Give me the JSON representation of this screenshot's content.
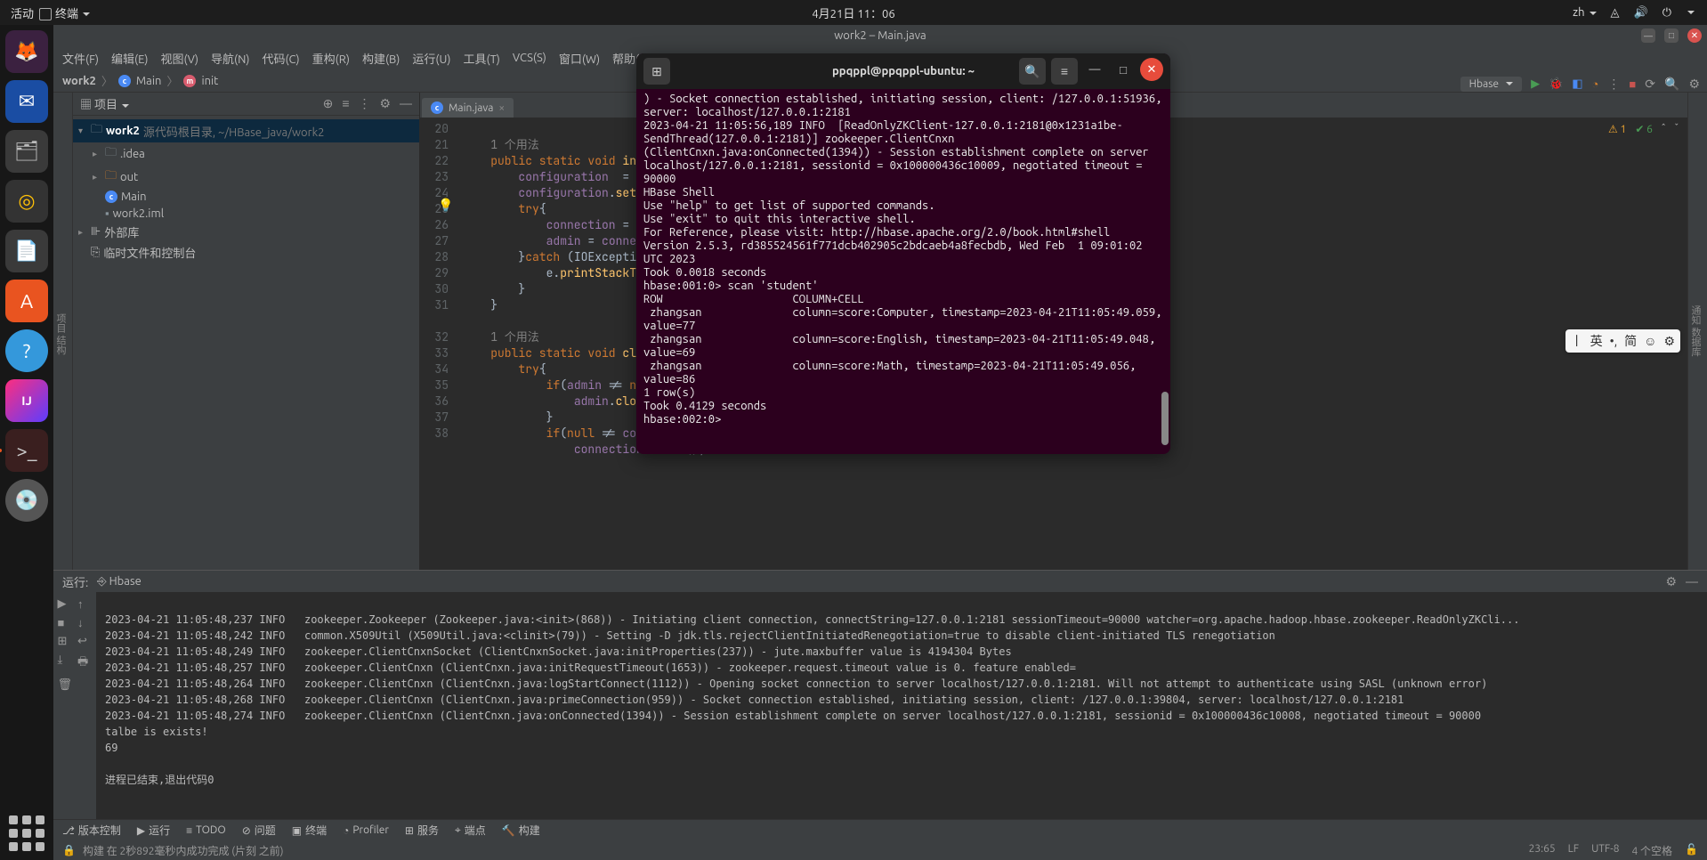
{
  "topbar": {
    "activities": "活动",
    "terminal": "终端",
    "clock": "4月21日 11：06",
    "lang": "zh"
  },
  "dock": {
    "ij": "IJ",
    "term": ">_"
  },
  "ide": {
    "title": "work2 – Main.java",
    "menu": {
      "file": "文件(F)",
      "edit": "编辑(E)",
      "view": "视图(V)",
      "nav": "导航(N)",
      "code": "代码(C)",
      "refactor": "重构(R)",
      "build": "构建(B)",
      "run": "运行(U)",
      "tools": "工具(T)",
      "vcs": "VCS(S)",
      "window": "窗口(W)",
      "help": "帮助(H)"
    },
    "breadcrumb": {
      "p1": "work2",
      "p2": "Main",
      "p3": "init"
    },
    "runconfig": "Hbase",
    "project": {
      "title": "项目",
      "root": "work2",
      "rootHint": "源代码根目录, ~/HBase_java/work2",
      "idea": ".idea",
      "out": "out",
      "main": "Main",
      "iml": "work2.iml",
      "extLib": "外部库",
      "scratch": "临时文件和控制台"
    },
    "editor": {
      "tab": "Main.java",
      "hint": "1 个用法",
      "lines": [
        "20",
        "21",
        "22",
        "23",
        "24",
        "25",
        "26",
        "27",
        "28",
        "29",
        "30",
        "31",
        "",
        "32",
        "33",
        "34",
        "35",
        "36",
        "37",
        "38"
      ],
      "warn": "1",
      "ok": "6"
    },
    "run": {
      "label": "运行:",
      "cfg": "Hbase",
      "out": [
        "2023-04-21 11:05:48,237 INFO   zookeeper.Zookeeper (Zookeeper.java:<init>(868)) - Initiating client connection, connectString=127.0.0.1:2181 sessionTimeout=90000 watcher=org.apache.hadoop.hbase.zookeeper.ReadOnlyZKCli...",
        "2023-04-21 11:05:48,242 INFO   common.X509Util (X509Util.java:<clinit>(79)) - Setting -D jdk.tls.rejectClientInitiatedRenegotiation=true to disable client-initiated TLS renegotiation",
        "2023-04-21 11:05:48,249 INFO   zookeeper.ClientCnxnSocket (ClientCnxnSocket.java:initProperties(237)) - jute.maxbuffer value is 4194304 Bytes",
        "2023-04-21 11:05:48,257 INFO   zookeeper.ClientCnxn (ClientCnxn.java:initRequestTimeout(1653)) - zookeeper.request.timeout value is 0. feature enabled=",
        "2023-04-21 11:05:48,264 INFO   zookeeper.ClientCnxn (ClientCnxn.java:logStartConnect(1112)) - Opening socket connection to server localhost/127.0.0.1:2181. Will not attempt to authenticate using SASL (unknown error)",
        "2023-04-21 11:05:48,268 INFO   zookeeper.ClientCnxn (ClientCnxn.java:primeConnection(959)) - Socket connection established, initiating session, client: /127.0.0.1:39804, server: localhost/127.0.0.1:2181",
        "2023-04-21 11:05:48,274 INFO   zookeeper.ClientCnxn (ClientCnxn.java:onConnected(1394)) - Session establishment complete on server localhost/127.0.0.1:2181, sessionid = 0x100000436c10008, negotiated timeout = 90000",
        "talbe is exists!",
        "69",
        "",
        "进程已结束,退出代码0"
      ]
    },
    "bottomTools": {
      "vcs": "版本控制",
      "run": "运行",
      "todo": "TODO",
      "problems": "问题",
      "terminal": "终端",
      "profiler": "Profiler",
      "services": "服务",
      "endpoints": "端点",
      "build": "构建"
    },
    "status": {
      "msg": "构建 在 2秒892毫秒内成功完成 (片刻 之前)",
      "pos": "23:65",
      "sep": "LF",
      "enc": "UTF-8",
      "indent": "4 个空格"
    }
  },
  "terminal": {
    "title": "ppqppl@ppqppl-ubuntu: ~",
    "text": ") - Socket connection established, initiating session, client: /127.0.0.1:51936, server: localhost/127.0.0.1:2181\n2023-04-21 11:05:56,189 INFO  [ReadOnlyZKClient-127.0.0.1:2181@0x1231a1be-SendThread(127.0.0.1:2181)] zookeeper.ClientCnxn (ClientCnxn.java:onConnected(1394)) - Session establishment complete on server localhost/127.0.0.1:2181, sessionid = 0x100000436c10009, negotiated timeout = 90000\nHBase Shell\nUse \"help\" to get list of supported commands.\nUse \"exit\" to quit this interactive shell.\nFor Reference, please visit: http://hbase.apache.org/2.0/book.html#shell\nVersion 2.5.3, rd385524561f771dcb402905c2bdcaeb4a8fecbdb, Wed Feb  1 09:01:02 UTC 2023\nTook 0.0018 seconds\nhbase:001:0> scan 'student'\nROW                    COLUMN+CELL\n zhangsan              column=score:Computer, timestamp=2023-04-21T11:05:49.059, value=77\n zhangsan              column=score:English, timestamp=2023-04-21T11:05:49.048, value=69\n zhangsan              column=score:Math, timestamp=2023-04-21T11:05:49.056, value=86\n1 row(s)\nTook 0.4129 seconds\nhbase:002:0> "
  },
  "ime": {
    "b1": "丨",
    "b2": "英",
    "b3": "•,",
    "b4": "简",
    "b5": "☺",
    "b6": "⚙"
  }
}
